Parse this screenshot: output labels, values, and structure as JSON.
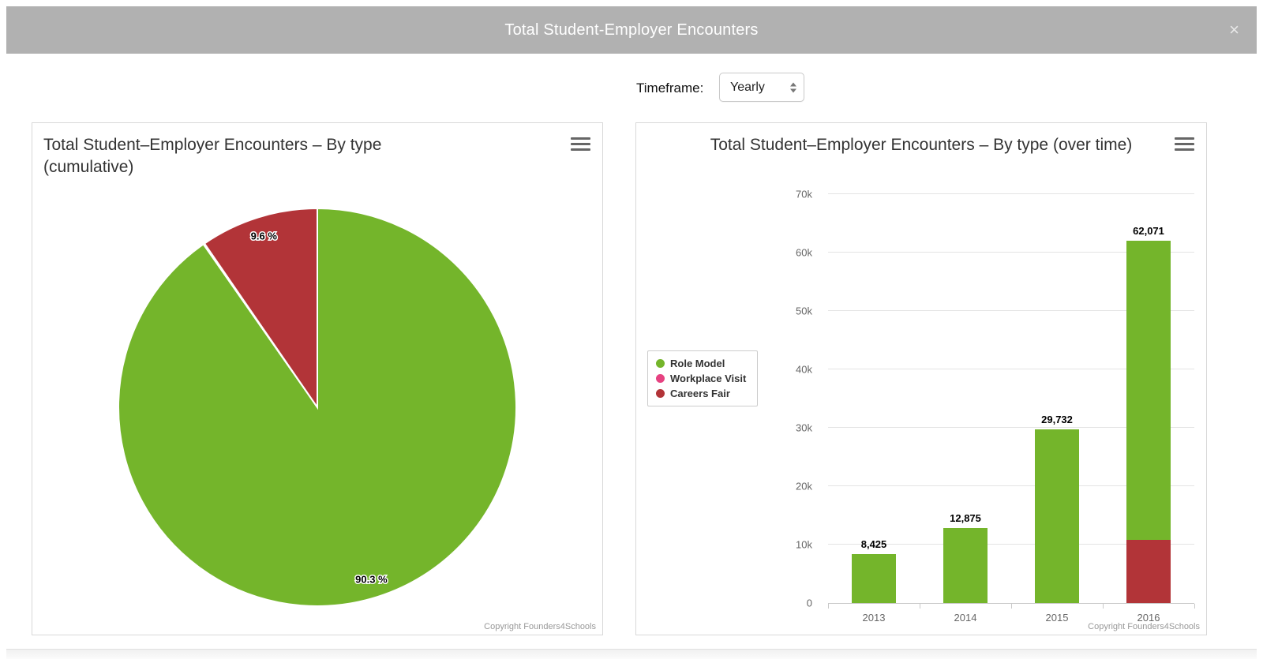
{
  "modal": {
    "title": "Total Student-Employer Encounters",
    "close": "×"
  },
  "controls": {
    "timeframe_label": "Timeframe:",
    "timeframe_value": "Yearly"
  },
  "colors": {
    "header_bg": "#b1b1b1",
    "green": "#74b52b",
    "pink": "#e64281",
    "red": "#b23438"
  },
  "chart_data": [
    {
      "type": "pie",
      "title": "Total Student–Employer Encounters – By type (cumulative)",
      "credit": "Copyright Founders4Schools",
      "start_angle": "top, clockwise",
      "slices": [
        {
          "name": "Role Model",
          "value": 90.3,
          "label": "90.3 %",
          "color": "#74b52b"
        },
        {
          "name": "Workplace Visit",
          "value": 0.1,
          "label": "",
          "color": "#e64281"
        },
        {
          "name": "Careers Fair",
          "value": 9.6,
          "label": "9.6 %",
          "color": "#b23438"
        }
      ]
    },
    {
      "type": "bar",
      "title": "Total Student–Employer Encounters – By type (over time)",
      "credit": "Copyright Founders4Schools",
      "categories": [
        "2013",
        "2014",
        "2015",
        "2016"
      ],
      "series": [
        {
          "name": "Careers Fair",
          "color": "#b23438",
          "values": [
            0,
            0,
            0,
            10800
          ]
        },
        {
          "name": "Workplace Visit",
          "color": "#e64281",
          "values": [
            0,
            0,
            0,
            0
          ]
        },
        {
          "name": "Role Model",
          "color": "#74b52b",
          "values": [
            8425,
            12875,
            29732,
            51271
          ]
        }
      ],
      "totals": [
        8425,
        12875,
        29732,
        62071
      ],
      "stack_labels": [
        "8,425",
        "12,875",
        "29,732",
        "62,071"
      ],
      "ylim": [
        0,
        70000
      ],
      "yticks": [
        "0",
        "10k",
        "20k",
        "30k",
        "40k",
        "50k",
        "60k",
        "70k"
      ],
      "grid": true,
      "legend_position": "left",
      "legend": [
        {
          "name": "Role Model",
          "color": "#74b52b"
        },
        {
          "name": "Workplace Visit",
          "color": "#e64281"
        },
        {
          "name": "Careers Fair",
          "color": "#b23438"
        }
      ]
    }
  ]
}
